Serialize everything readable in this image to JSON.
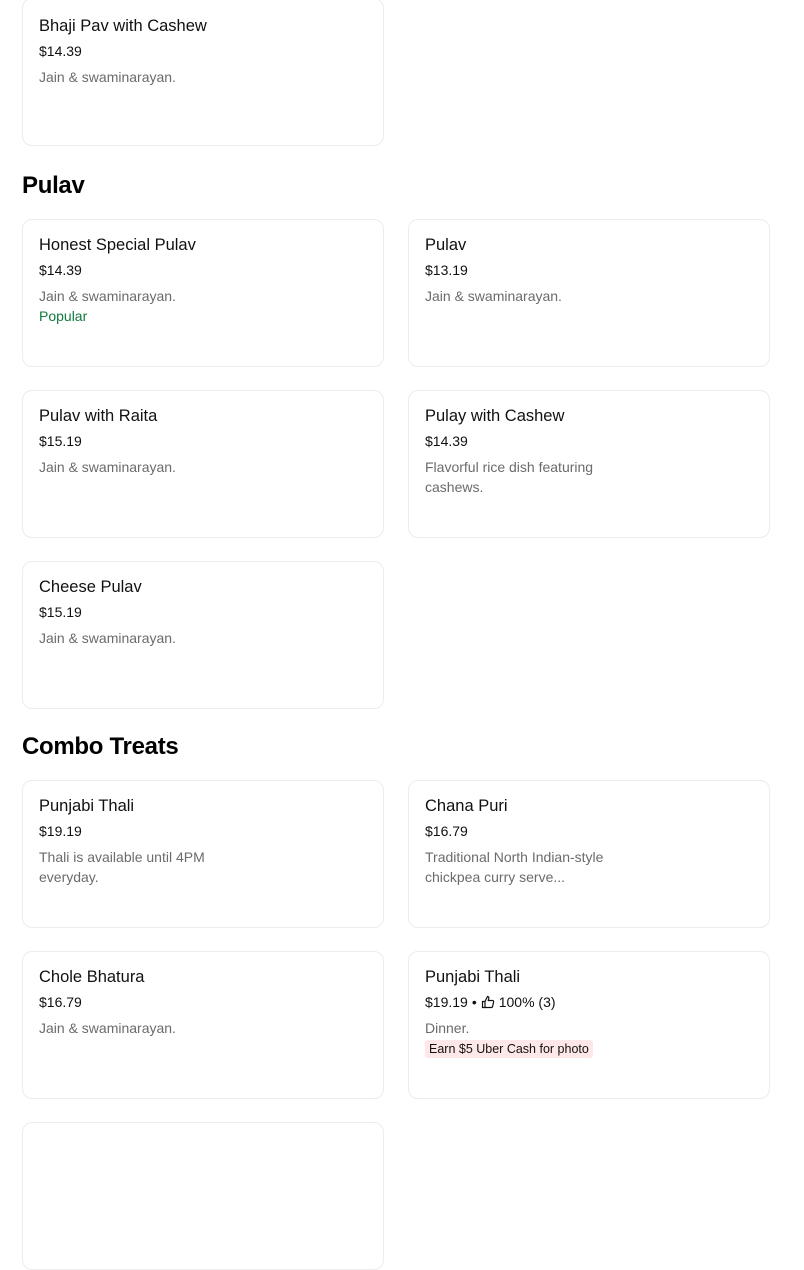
{
  "top_item": {
    "name": "Bhaji Pav with Cashew",
    "price": "$14.39",
    "desc": "Jain & swaminarayan."
  },
  "sections": [
    {
      "title": "Pulav",
      "items": [
        {
          "name": "Honest Special Pulav",
          "price": "$14.39",
          "desc": "Jain & swaminarayan.",
          "badge": "Popular"
        },
        {
          "name": "Pulav",
          "price": "$13.19",
          "desc": "Jain & swaminarayan."
        },
        {
          "name": "Pulav with Raita",
          "price": "$15.19",
          "desc": "Jain & swaminarayan."
        },
        {
          "name": "Pulay with Cashew",
          "price": "$14.39",
          "desc": "Flavorful rice dish featuring cashews."
        },
        {
          "name": "Cheese Pulav",
          "price": "$15.19",
          "desc": "Jain & swaminarayan."
        }
      ]
    },
    {
      "title": "Combo Treats",
      "items": [
        {
          "name": "Punjabi Thali",
          "price": "$19.19",
          "desc": "Thali is available until 4PM everyday."
        },
        {
          "name": "Chana Puri",
          "price": "$16.79",
          "desc": "Traditional North Indian-style chickpea curry serve..."
        },
        {
          "name": "Chole Bhatura",
          "price": "$16.79",
          "desc": "Jain & swaminarayan."
        },
        {
          "name": "Punjabi Thali",
          "price": "$19.19",
          "separator": "•",
          "rating": "100% (3)",
          "desc": "Dinner.",
          "promo": "Earn $5 Uber Cash for photo"
        }
      ]
    }
  ],
  "icons": {
    "rating": "thumbs-up-icon"
  },
  "colors": {
    "popular": "#117a3e",
    "promo_bg": "#fde8e7",
    "muted_text": "#6b6b6b"
  }
}
